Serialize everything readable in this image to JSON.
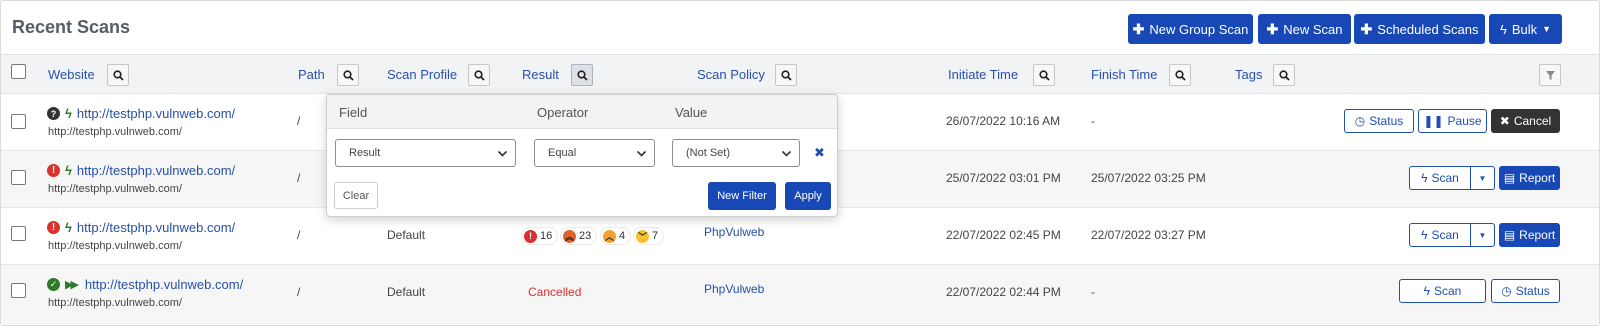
{
  "header": {
    "title": "Recent Scans",
    "buttons": {
      "new_group_scan": "New Group Scan",
      "new_scan": "New Scan",
      "scheduled_scans": "Scheduled Scans",
      "bulk": "Bulk"
    }
  },
  "columns": {
    "website": "Website",
    "path": "Path",
    "scan_profile": "Scan Profile",
    "result": "Result",
    "scan_policy": "Scan Policy",
    "initiate_time": "Initiate Time",
    "finish_time": "Finish Time",
    "tags": "Tags"
  },
  "rows": [
    {
      "status_icon": "question-circle-icon",
      "mode_icon": "bolt-icon",
      "url": "http://testphp.vulnweb.com/",
      "sub_url": "http://testphp.vulnweb.com/",
      "path": "/",
      "profile": "",
      "result": "",
      "policy": "",
      "initiate_time": "26/07/2022 10:16 AM",
      "finish_time": "-",
      "actions": {
        "status": "Status",
        "pause": "Pause",
        "cancel": "Cancel"
      }
    },
    {
      "status_icon": "exclamation-circle-icon",
      "mode_icon": "bolt-icon",
      "url": "http://testphp.vulnweb.com/",
      "sub_url": "http://testphp.vulnweb.com/",
      "path": "/",
      "profile": "",
      "result": "",
      "policy": "",
      "initiate_time": "25/07/2022 03:01 PM",
      "finish_time": "25/07/2022 03:25 PM",
      "actions": {
        "scan": "Scan",
        "report": "Report"
      }
    },
    {
      "status_icon": "exclamation-circle-icon",
      "mode_icon": "bolt-icon",
      "url": "http://testphp.vulnweb.com/",
      "sub_url": "http://testphp.vulnweb.com/",
      "path": "/",
      "profile": "Default",
      "severity_counts": {
        "critical": "16",
        "high": "23",
        "medium": "4",
        "low": "7"
      },
      "policy": "PhpVulweb",
      "initiate_time": "22/07/2022 02:45 PM",
      "finish_time": "22/07/2022 03:27 PM",
      "actions": {
        "scan": "Scan",
        "report": "Report"
      }
    },
    {
      "status_icon": "check-circle-icon",
      "mode_icon": "fast-forward-icon",
      "url": "http://testphp.vulnweb.com/",
      "sub_url": "http://testphp.vulnweb.com/",
      "path": "/",
      "profile": "Default",
      "result": "Cancelled",
      "policy": "PhpVulweb",
      "initiate_time": "22/07/2022 02:44 PM",
      "finish_time": "-",
      "actions": {
        "scan": "Scan",
        "status": "Status"
      }
    }
  ],
  "filter_popup": {
    "headers": {
      "field": "Field",
      "operator": "Operator",
      "value": "Value"
    },
    "field_value": "Result",
    "operator_value": "Equal",
    "value_value": "(Not Set)",
    "clear": "Clear",
    "new_filter": "New Filter",
    "apply": "Apply"
  },
  "colors": {
    "primary": "#1748b5",
    "link": "#2650a8",
    "danger": "#d9312d",
    "success": "#2b7a2b",
    "dark": "#333333"
  }
}
